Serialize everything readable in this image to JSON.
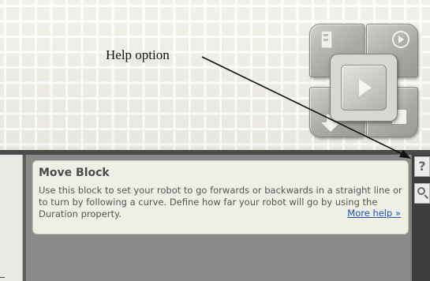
{
  "annotation": {
    "text": "Help option"
  },
  "controller": {
    "buttons": [
      "download-and-run",
      "run-selected",
      "download",
      "stop"
    ],
    "center_button": "play"
  },
  "help": {
    "button_label": "?",
    "title": "Move Block",
    "description": "Use this block to set your robot to go forwards or backwards in a straight line or to turn by following a curve. Define how far your robot will go by using the Duration property.",
    "more_link": "More help »"
  },
  "icons": [
    "question-icon",
    "search-icon",
    "play-icon",
    "stop-icon",
    "download-icon",
    "run-icon"
  ],
  "colors": {
    "link": "#1f4fbf",
    "panel_bg": "#f0efe6",
    "title": "#4b4b4b"
  }
}
